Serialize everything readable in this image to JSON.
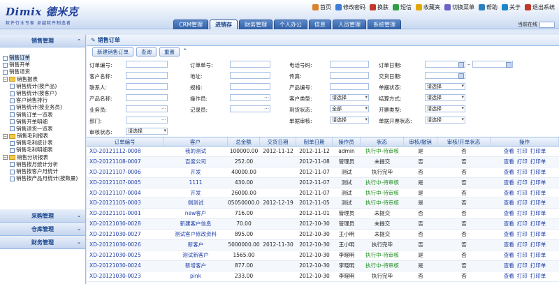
{
  "header": {
    "logo_title": "Dimix 德米克",
    "logo_subtitle": "软件行业专家  卓越软件制造者",
    "top_links": [
      {
        "label": "首页",
        "icon": "home-icon",
        "color": "#d9812b"
      },
      {
        "label": "修改密码",
        "icon": "key-icon",
        "color": "#3b7dd8"
      },
      {
        "label": "换肤",
        "icon": "palette-icon",
        "color": "#c0392b"
      },
      {
        "label": "短信",
        "icon": "message-icon",
        "color": "#2f9e44"
      },
      {
        "label": "收藏夹",
        "icon": "star-icon",
        "color": "#e0a800"
      },
      {
        "label": "切换菜单",
        "icon": "menu-icon",
        "color": "#6c63c7"
      },
      {
        "label": "帮助",
        "icon": "help-icon",
        "color": "#2a7fbd"
      },
      {
        "label": "关于",
        "icon": "info-icon",
        "color": "#1b87c9"
      },
      {
        "label": "退出系统",
        "icon": "exit-icon",
        "color": "#c0392b"
      }
    ],
    "tabs": [
      {
        "label": "CRM管理",
        "active": false
      },
      {
        "label": "进销存",
        "active": true
      },
      {
        "label": "财务管理",
        "active": false
      },
      {
        "label": "个人办公",
        "active": false
      },
      {
        "label": "信息",
        "active": false
      },
      {
        "label": "人员管理",
        "active": false
      },
      {
        "label": "系统管理",
        "active": false
      }
    ],
    "status_label": "当前在线"
  },
  "sidebar": {
    "title": "销售管理",
    "tree": [
      {
        "label": "销售订单",
        "type": "leaf",
        "indent": 0,
        "selected": true
      },
      {
        "label": "销售开单",
        "type": "leaf",
        "indent": 0,
        "selected": false
      },
      {
        "label": "销售退货",
        "type": "leaf",
        "indent": 0,
        "selected": false
      },
      {
        "label": "销售报表",
        "type": "folder",
        "indent": 0,
        "selected": false
      },
      {
        "label": "销售统计(按产品)",
        "type": "leaf",
        "indent": 1,
        "selected": false
      },
      {
        "label": "销售统计(按客户)",
        "type": "leaf",
        "indent": 1,
        "selected": false
      },
      {
        "label": "客户销售排行",
        "type": "leaf",
        "indent": 1,
        "selected": false
      },
      {
        "label": "销售统计(按业务员)",
        "type": "leaf",
        "indent": 1,
        "selected": false
      },
      {
        "label": "销售订单一览表",
        "type": "leaf",
        "indent": 1,
        "selected": false
      },
      {
        "label": "销售开单明细",
        "type": "leaf",
        "indent": 1,
        "selected": false
      },
      {
        "label": "销售退货一览表",
        "type": "leaf",
        "indent": 1,
        "selected": false
      },
      {
        "label": "销售毛利报表",
        "type": "folder",
        "indent": 0,
        "selected": false
      },
      {
        "label": "销售毛利统计表",
        "type": "leaf",
        "indent": 1,
        "selected": false
      },
      {
        "label": "销售毛利明细表",
        "type": "leaf",
        "indent": 1,
        "selected": false
      },
      {
        "label": "销售分析报表",
        "type": "folder",
        "indent": 0,
        "selected": false
      },
      {
        "label": "销售按月统计分析",
        "type": "leaf",
        "indent": 1,
        "selected": false
      },
      {
        "label": "销售按客户月统计",
        "type": "leaf",
        "indent": 1,
        "selected": false
      },
      {
        "label": "销售按产品月统计(按数量)",
        "type": "leaf",
        "indent": 1,
        "selected": false
      }
    ],
    "panels": [
      "采购管理",
      "仓库管理",
      "财务管理"
    ]
  },
  "main": {
    "title": "销售订单",
    "buttons": [
      "新建销售订单",
      "查询",
      "重置"
    ],
    "form": {
      "labels": {
        "order_no": "订单编号:",
        "customer": "客户名称:",
        "contact": "联系人:",
        "product_name": "产品名称:",
        "salesman": "业务员:",
        "dept": "部门:",
        "status": "审核状态:",
        "contract_no": "订单单号:",
        "address": "地址:",
        "spec": "规格:",
        "operator": "操作员:",
        "recorder": "记录员:",
        "phone": "电话号码:",
        "fax": "传真:",
        "product_no": "产品编号:",
        "cust_type": "客户类型:",
        "arrival": "到货状态:",
        "approve": "单据审核:",
        "order_date": "订单日期:",
        "delivery_date": "交货日期:",
        "payment": "单据状态:",
        "settle": "结算方式:",
        "invoice": "开票类型:",
        "bill_status": "单据开票状态:"
      },
      "select_default": "请选择",
      "all_option": "全部"
    },
    "grid": {
      "columns": [
        "订单编号",
        "客户",
        "总金额",
        "交货日期",
        "制单日期",
        "操作员",
        "状态",
        "审核/撤销",
        "审核/开单状态",
        "操作"
      ],
      "rows": [
        {
          "code": "XD-20121112-0008",
          "customer": "我的测试",
          "amount": "100000.00",
          "delivery": "2012-11-12",
          "created": "2012-11-12",
          "operator": "admin",
          "status": "执行中-待审核",
          "audit": "是",
          "bill": "否"
        },
        {
          "code": "XD-20121108-0007",
          "customer": "百度公司",
          "amount": "252.00",
          "delivery": "",
          "created": "2012-11-08",
          "operator": "管理员",
          "status": "未提交",
          "audit": "否",
          "bill": "否"
        },
        {
          "code": "XD-20121107-0006",
          "customer": "开发",
          "amount": "40000.00",
          "delivery": "",
          "created": "2012-11-07",
          "operator": "测试",
          "status": "执行完毕",
          "audit": "否",
          "bill": "否"
        },
        {
          "code": "XD-20121107-0005",
          "customer": "1111",
          "amount": "430.00",
          "delivery": "",
          "created": "2012-11-07",
          "operator": "测试",
          "status": "执行中-待审核",
          "audit": "是",
          "bill": "否"
        },
        {
          "code": "XD-20121107-0004",
          "customer": "开发",
          "amount": "26000.00",
          "delivery": "",
          "created": "2012-11-07",
          "operator": "测试",
          "status": "执行中-待审核",
          "audit": "是",
          "bill": "否"
        },
        {
          "code": "XD-20121105-0003",
          "customer": "侧测试",
          "amount": "05050000.00",
          "delivery": "2012-12-19",
          "created": "2012-11-05",
          "operator": "测试",
          "status": "执行中-待审核",
          "audit": "是",
          "bill": "否"
        },
        {
          "code": "XD-20121101-0001",
          "customer": "new客户",
          "amount": "716.00",
          "delivery": "",
          "created": "2012-11-01",
          "operator": "管理员",
          "status": "未提交",
          "audit": "否",
          "bill": "否"
        },
        {
          "code": "XD-20121030-0028",
          "customer": "新建客户信息",
          "amount": "70.00",
          "delivery": "",
          "created": "2012-10-30",
          "operator": "管理员",
          "status": "未提交",
          "audit": "否",
          "bill": "否"
        },
        {
          "code": "XD-20121030-0027",
          "customer": "测试客户修改资料",
          "amount": "895.00",
          "delivery": "",
          "created": "2012-10-30",
          "operator": "王小明",
          "status": "未提交",
          "audit": "否",
          "bill": "否"
        },
        {
          "code": "XD-20121030-0026",
          "customer": "新客户",
          "amount": "5000000.00",
          "delivery": "2012-11-30",
          "created": "2012-10-30",
          "operator": "王小明",
          "status": "执行完毕",
          "audit": "否",
          "bill": "否"
        },
        {
          "code": "XD-20121030-0025",
          "customer": "测试新客户",
          "amount": "1565.00",
          "delivery": "",
          "created": "2012-10-30",
          "operator": "李晓明",
          "status": "执行中-待审核",
          "audit": "是",
          "bill": "否"
        },
        {
          "code": "XD-20121030-0024",
          "customer": "新增客户",
          "amount": "877.00",
          "delivery": "",
          "created": "2012-10-30",
          "operator": "李晓明",
          "status": "执行中-待审核",
          "audit": "是",
          "bill": "否"
        },
        {
          "code": "XD-20121030-0023",
          "customer": "pink",
          "amount": "233.00",
          "delivery": "",
          "created": "2012-10-30",
          "operator": "李晓明",
          "status": "执行完毕",
          "audit": "否",
          "bill": "否"
        }
      ],
      "actions": [
        "查看",
        "打印",
        "打印单"
      ]
    }
  }
}
